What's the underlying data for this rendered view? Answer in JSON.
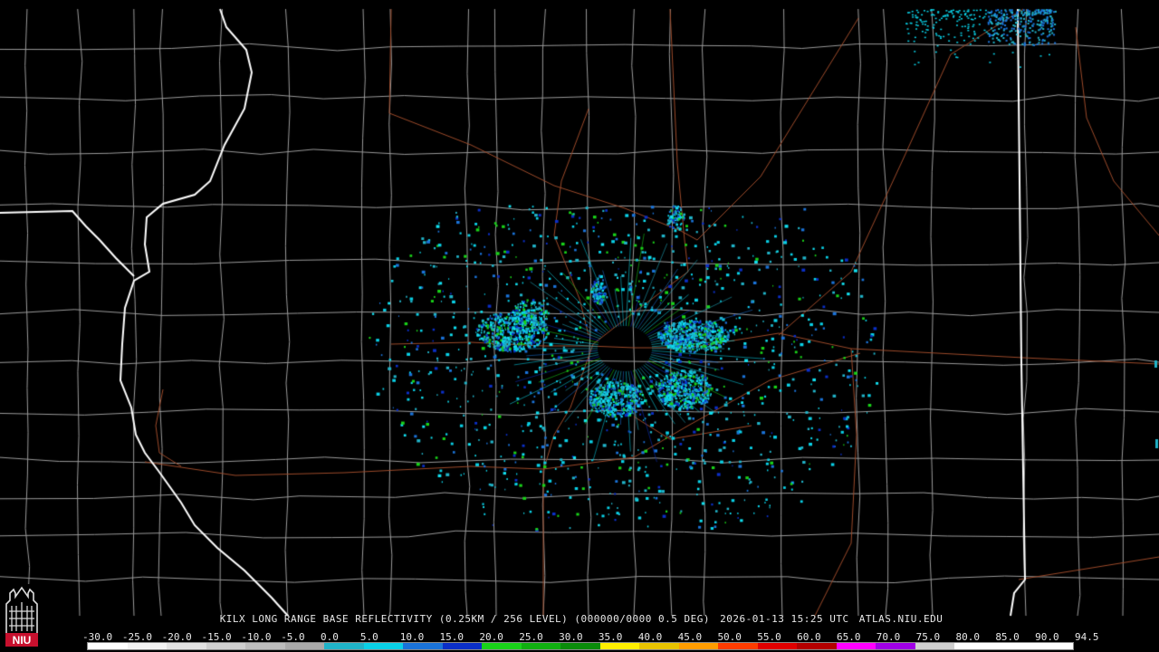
{
  "caption": {
    "radar_product": "KILX LONG RANGE BASE REFLECTIVITY (0.25KM / 256 LEVEL) (000000/0000 0.5 DEG)",
    "timestamp": "2026-01-13 15:25 UTC",
    "site": "ATLAS.NIU.EDU"
  },
  "color_scale": {
    "labels": [
      "-30.0",
      "-25.0",
      "-20.0",
      "-15.0",
      "-10.0",
      "-5.0",
      "0.0",
      "5.0",
      "10.0",
      "15.0",
      "20.0",
      "25.0",
      "30.0",
      "35.0",
      "40.0",
      "45.0",
      "50.0",
      "55.0",
      "60.0",
      "65.0",
      "70.0",
      "75.0",
      "80.0",
      "85.0",
      "90.0",
      "94.5"
    ],
    "colors": [
      "#ffffff",
      "#f2f2f2",
      "#e2e2e2",
      "#cfcfcf",
      "#bdbdbd",
      "#aaaaaa",
      "#20b3c8",
      "#0ad0e6",
      "#1a73d9",
      "#0b2fc8",
      "#19d219",
      "#10b010",
      "#0a8c0a",
      "#ffee00",
      "#e8c300",
      "#ff9c00",
      "#ff3c00",
      "#e10000",
      "#b40000",
      "#ff00ff",
      "#a000e6",
      "#d0d0d0",
      "#ffffff",
      "#ffffff",
      "#ffffff"
    ]
  },
  "logo": {
    "text": "NIU",
    "icon": "niu-tower-logo-icon",
    "color": "#c8102e"
  },
  "map": {
    "radar_site": "KILX",
    "colors": {
      "county_lines": "#9a9a9a",
      "state_lines": "#ffffff",
      "highways": "#9c4a2a",
      "background": "#000000"
    }
  }
}
